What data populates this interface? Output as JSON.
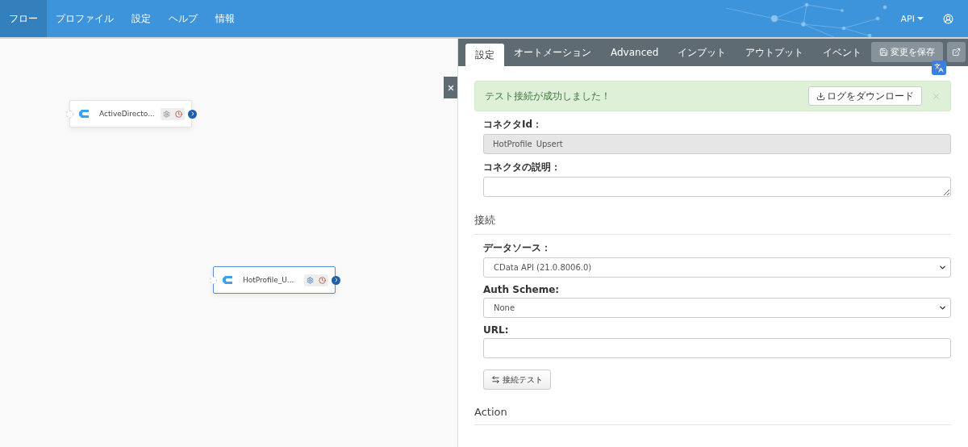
{
  "nav": {
    "items": [
      {
        "label": "フロー",
        "selected": true
      },
      {
        "label": "プロファイル",
        "selected": false
      },
      {
        "label": "設定",
        "selected": false
      },
      {
        "label": "ヘルプ",
        "selected": false
      },
      {
        "label": "情報",
        "selected": false
      }
    ],
    "api_menu": "API"
  },
  "canvas": {
    "nodes": [
      {
        "label": "ActiveDirecto...",
        "selected": false
      },
      {
        "label": "HotProfile_U...",
        "selected": true
      }
    ]
  },
  "panel": {
    "tabs": [
      {
        "label": "設定",
        "selected": true
      },
      {
        "label": "オートメーション",
        "selected": false
      },
      {
        "label": "Advanced",
        "selected": false
      },
      {
        "label": "インプット",
        "selected": false
      },
      {
        "label": "アウトプット",
        "selected": false
      },
      {
        "label": "イベント",
        "selected": false
      }
    ],
    "save_button": "変更を保存",
    "alert": {
      "message": "テスト接続が成功しました！",
      "download_button": "ログをダウンロード"
    },
    "items": [
      {
        "kind": "input",
        "label": "コネクタId：",
        "value": "HotProfile_Upsert",
        "disabled": true
      },
      {
        "kind": "textarea",
        "label": "コネクタの説明："
      },
      {
        "kind": "heading",
        "label": "接続"
      },
      {
        "kind": "select",
        "label": "データソース：",
        "value": "CData API (21.0.8006.0)"
      },
      {
        "kind": "select",
        "label": "Auth Scheme:",
        "value": "None"
      },
      {
        "kind": "input",
        "label": "URL:",
        "disabled": false
      },
      {
        "kind": "button",
        "label": "接続テスト"
      },
      {
        "kind": "heading",
        "label": "Action"
      }
    ]
  }
}
